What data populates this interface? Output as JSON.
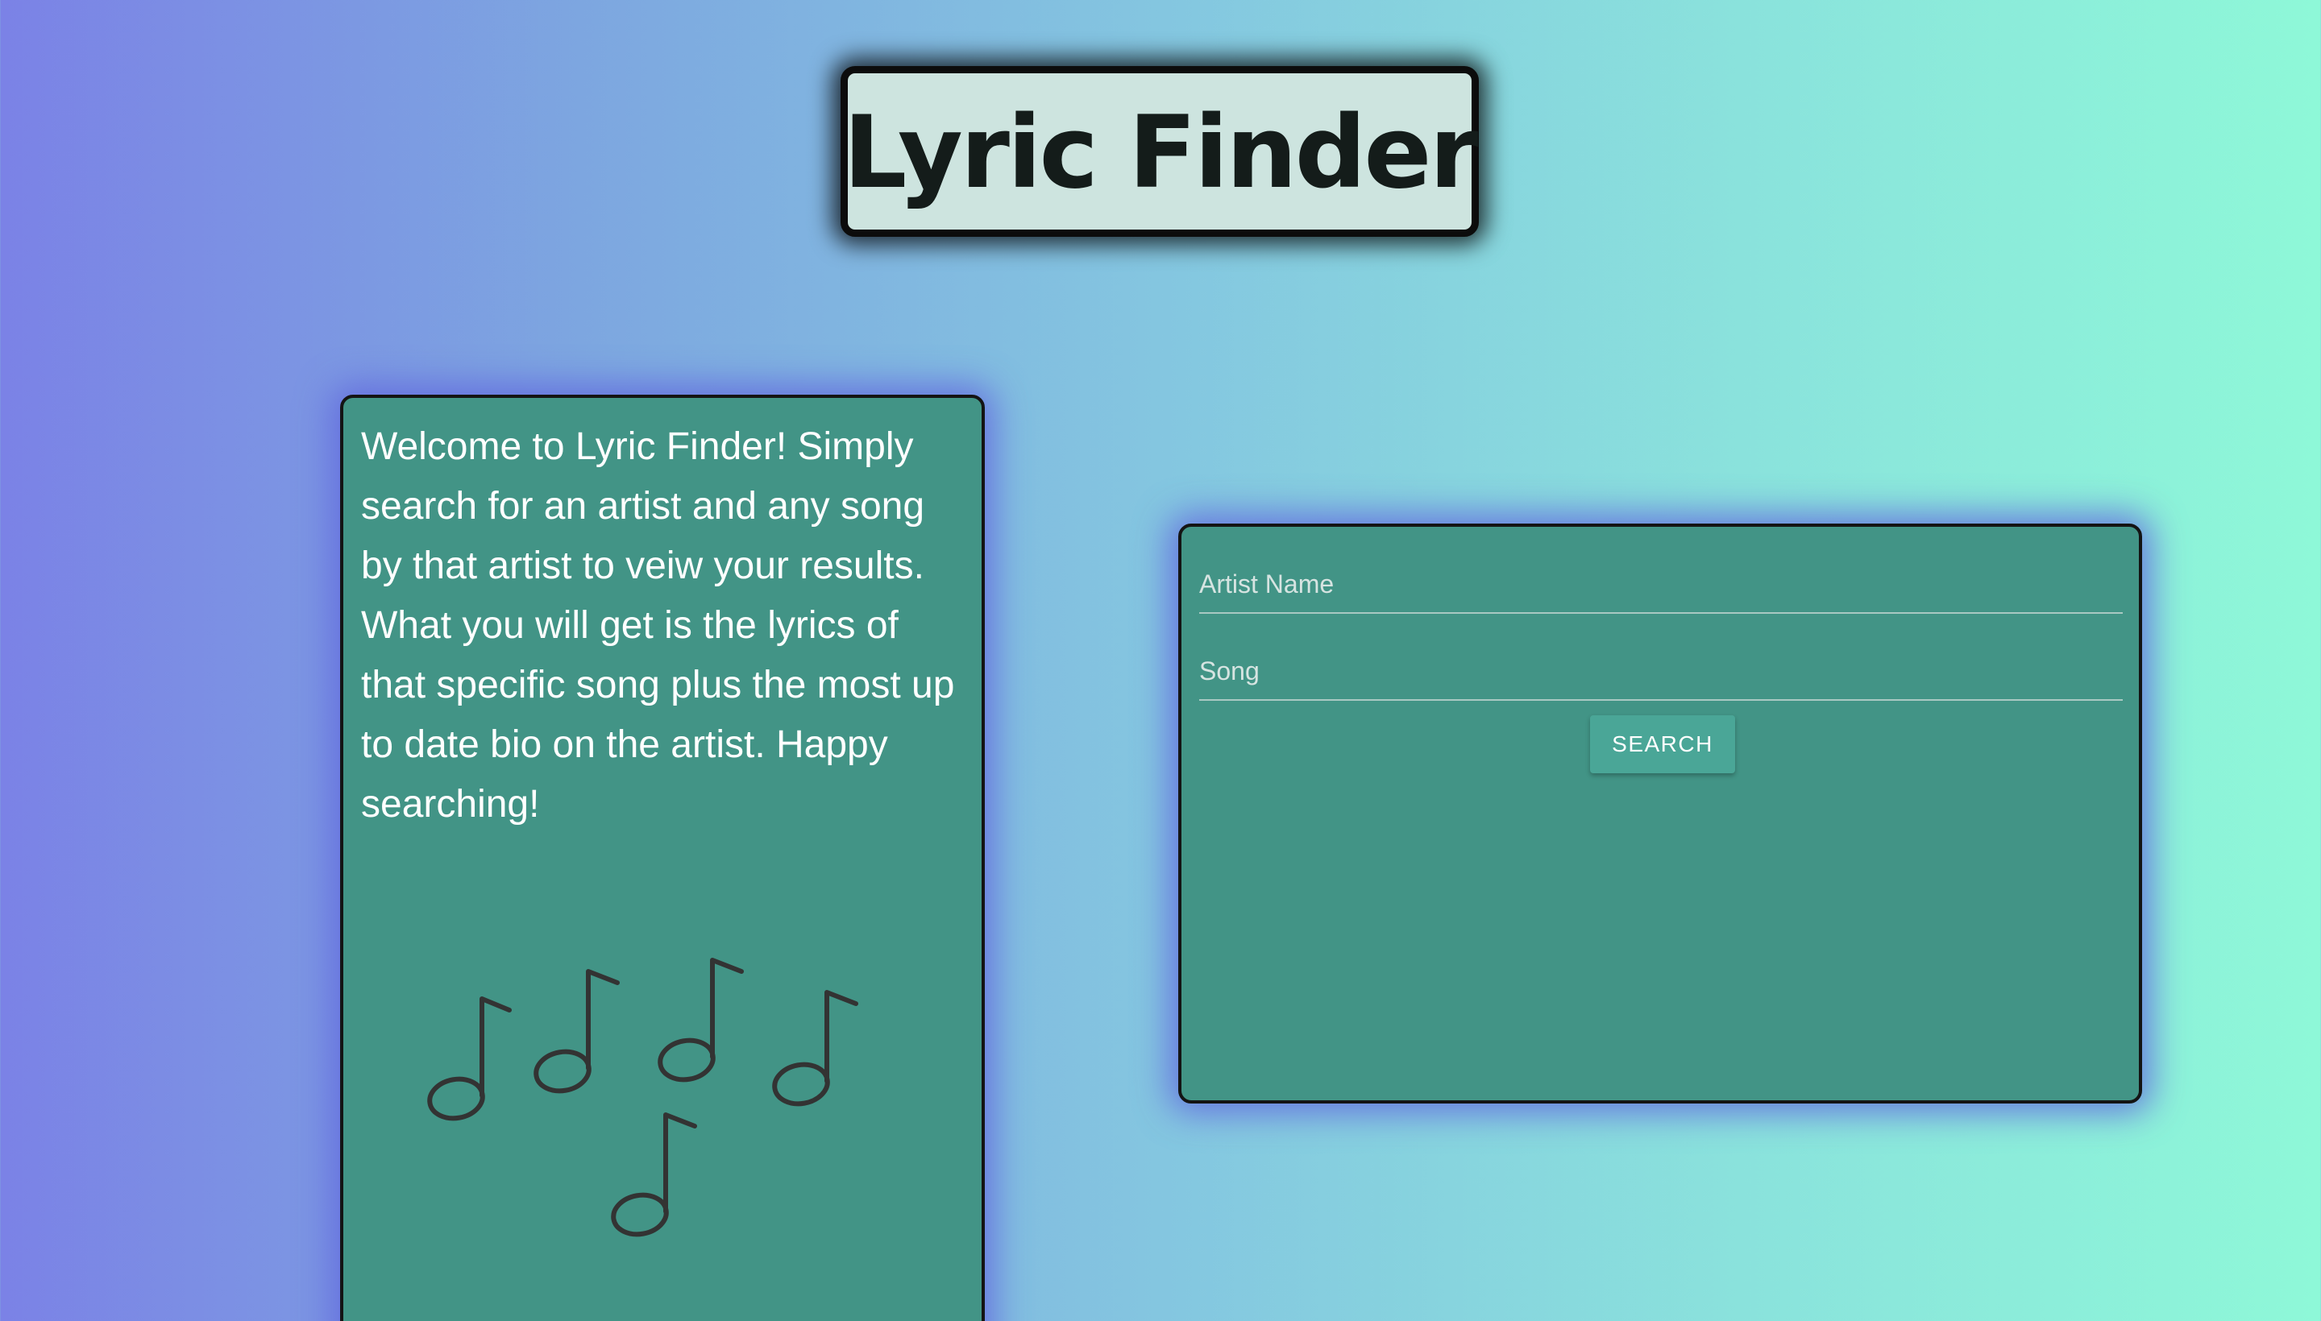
{
  "header": {
    "title": "Lyric Finder"
  },
  "welcome": {
    "text": "Welcome to Lyric Finder! Simply search for an artist and any song by that artist to veiw your results. What you will get is the lyrics of that specific song plus the most up to date bio on the artist. Happy searching!",
    "decoration_icon": "music-notes-icon"
  },
  "search_form": {
    "artist_placeholder": "Artist Name",
    "artist_value": "",
    "song_placeholder": "Song",
    "song_value": "",
    "search_label": "SEARCH"
  },
  "colors": {
    "gradient_start": "#7b82e6",
    "gradient_end": "#8ef8d8",
    "card_background": "#429486",
    "title_background": "#cde4df",
    "button_background": "#4aa697"
  }
}
